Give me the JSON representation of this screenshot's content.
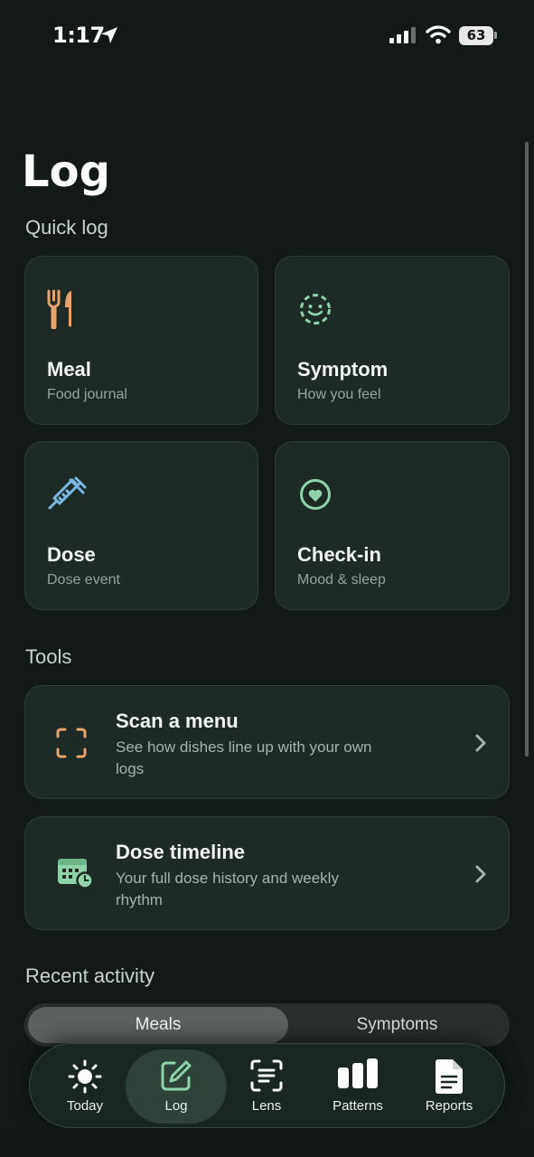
{
  "status_bar": {
    "time": "1:17",
    "battery": "63"
  },
  "page": {
    "title": "Log"
  },
  "sections": {
    "quick_log": "Quick log",
    "tools": "Tools",
    "recent_activity": "Recent activity"
  },
  "quick_log": [
    {
      "title": "Meal",
      "subtitle": "Food journal",
      "icon": "fork-knife-icon"
    },
    {
      "title": "Symptom",
      "subtitle": "How you feel",
      "icon": "smiley-face-icon"
    },
    {
      "title": "Dose",
      "subtitle": "Dose event",
      "icon": "syringe-icon"
    },
    {
      "title": "Check-in",
      "subtitle": "Mood & sleep",
      "icon": "heart-circle-icon"
    }
  ],
  "tools": [
    {
      "title": "Scan a menu",
      "description": "See how dishes line up with your own logs",
      "icon": "scan-frame-icon"
    },
    {
      "title": "Dose timeline",
      "description": "Your full dose history and weekly rhythm",
      "icon": "calendar-clock-icon"
    }
  ],
  "recent_activity": {
    "tabs": [
      "Meals",
      "Symptoms"
    ],
    "selected": "Meals"
  },
  "tab_bar": [
    {
      "label": "Today",
      "icon": "sun-icon"
    },
    {
      "label": "Log",
      "icon": "edit-square-icon",
      "active": true
    },
    {
      "label": "Lens",
      "icon": "scan-text-icon"
    },
    {
      "label": "Patterns",
      "icon": "bar-chart-icon"
    },
    {
      "label": "Reports",
      "icon": "document-icon"
    }
  ],
  "colors": {
    "background": "#121916",
    "card": "#1d2a25",
    "accent_orange": "#e9a46e",
    "accent_green": "#8fd4a8",
    "accent_blue": "#7ab8e4"
  }
}
